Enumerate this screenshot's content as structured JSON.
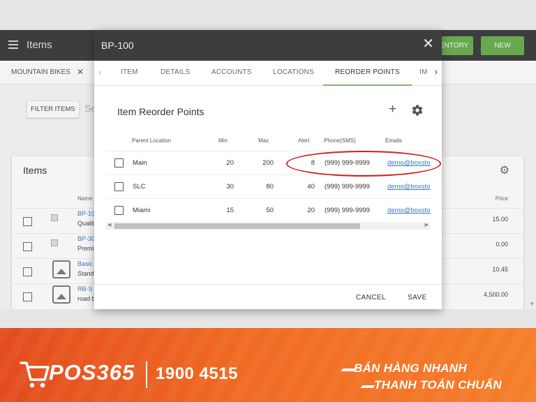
{
  "app": {
    "title": "Items",
    "buttons": {
      "inventory": "ENTORY",
      "new": "NEW"
    },
    "tab": {
      "label": "MOUNTAIN BIKES",
      "close": "✕"
    },
    "filter_button": "FILTER ITEMS",
    "search_placeholder": "Se",
    "card": {
      "title": "Items",
      "col_name": "Name",
      "col_price": "Price",
      "rows": [
        {
          "name": "BP-10",
          "sub": "Qualit",
          "price": "15.00"
        },
        {
          "name": "BP-30",
          "sub": "Premi",
          "price": "0.00"
        },
        {
          "name": "Basic",
          "sub": "Stand",
          "price": "10.45"
        },
        {
          "name": "RB-S",
          "sub": "road b",
          "price": "4,500.00"
        }
      ]
    }
  },
  "modal": {
    "title": "BP-100",
    "close": "✕",
    "tabs": [
      {
        "label": "ITEM",
        "active": false
      },
      {
        "label": "DETAILS",
        "active": false
      },
      {
        "label": "ACCOUNTS",
        "active": false
      },
      {
        "label": "LOCATIONS",
        "active": false
      },
      {
        "label": "REORDER POINTS",
        "active": true
      },
      {
        "label": "IM",
        "active": false
      }
    ],
    "section_title": "Item Reorder Points",
    "add_label": "+",
    "grid": {
      "headers": {
        "location": "Parent Location",
        "min": "Min",
        "max": "Max",
        "alert": "Alert",
        "phone": "Phone(SMS)",
        "emails": "Emails"
      },
      "rows": [
        {
          "location": "Main",
          "min": "20",
          "max": "200",
          "alert": "8",
          "phone": "(999) 999-9999",
          "email": "demo@boxstor"
        },
        {
          "location": "SLC",
          "min": "30",
          "max": "80",
          "alert": "40",
          "phone": "(999) 999-9999",
          "email": "demo@boxstor"
        },
        {
          "location": "Miami",
          "min": "15",
          "max": "50",
          "alert": "20",
          "phone": "(999) 999-9999",
          "email": "demo@boxstor"
        }
      ],
      "scroll_position": 0.0
    },
    "footer": {
      "cancel": "CANCEL",
      "save": "SAVE"
    }
  },
  "banner": {
    "brand": "POS365",
    "hotline": "1900 4515",
    "slogan_line1": "BÁN HÀNG NHANH",
    "slogan_line2": "THANH TOÁN CHUẨN"
  },
  "colors": {
    "header_dark": "#3b3d3f",
    "accent_green": "#6aa84f",
    "link_blue": "#3a78c3",
    "highlight_red": "#d11f1f",
    "banner_orange": "#f06a23"
  }
}
